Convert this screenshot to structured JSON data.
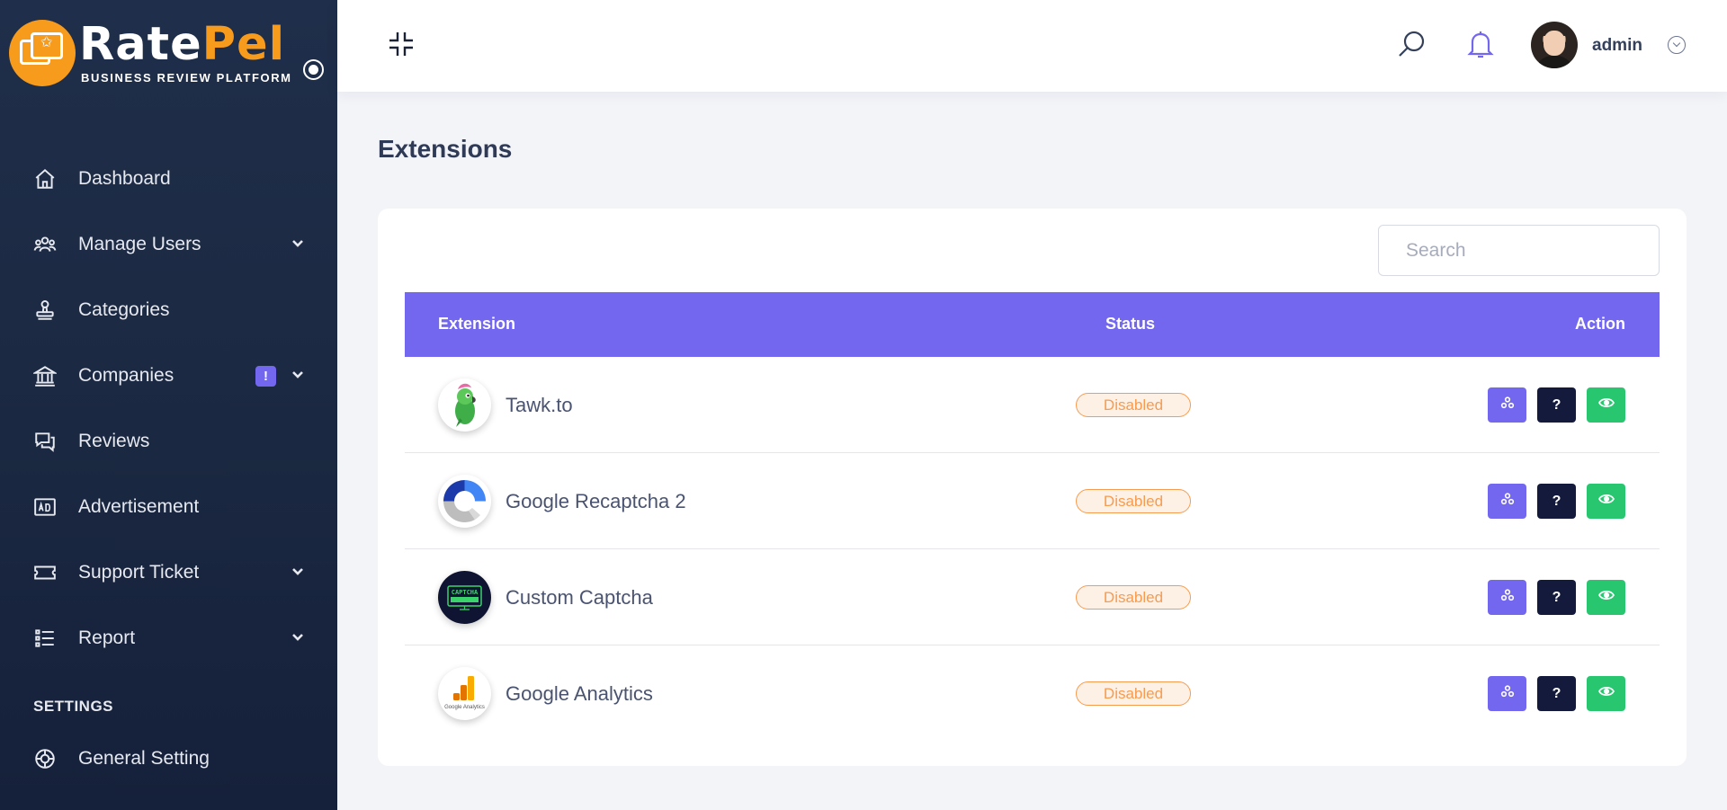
{
  "brand": {
    "name_part1": "Rate",
    "name_part2": "Pel",
    "tagline": "BUSINESS REVIEW PLATFORM"
  },
  "sidebar": {
    "items": [
      {
        "label": "Dashboard",
        "icon": "home-icon"
      },
      {
        "label": "Manage Users",
        "icon": "users-icon",
        "has_submenu": true
      },
      {
        "label": "Categories",
        "icon": "stamp-icon"
      },
      {
        "label": "Companies",
        "icon": "bank-icon",
        "has_submenu": true,
        "badge": "!"
      },
      {
        "label": "Reviews",
        "icon": "chat-icon"
      },
      {
        "label": "Advertisement",
        "icon": "ad-icon"
      },
      {
        "label": "Support Ticket",
        "icon": "ticket-icon",
        "has_submenu": true
      },
      {
        "label": "Report",
        "icon": "list-icon",
        "has_submenu": true
      }
    ],
    "section_label": "SETTINGS",
    "settings_items": [
      {
        "label": "General Setting",
        "icon": "settings-icon"
      }
    ]
  },
  "header": {
    "user_name": "admin"
  },
  "page": {
    "title": "Extensions"
  },
  "search": {
    "placeholder": "Search",
    "value": ""
  },
  "table": {
    "columns": [
      "Extension",
      "Status",
      "Action"
    ],
    "rows": [
      {
        "name": "Tawk.to",
        "status": "Disabled",
        "logo": "tawkto-parrot-icon"
      },
      {
        "name": "Google Recaptcha 2",
        "status": "Disabled",
        "logo": "recaptcha-icon"
      },
      {
        "name": "Custom Captcha",
        "status": "Disabled",
        "logo": "custom-captcha-icon",
        "logo_text": "CAPTCHA"
      },
      {
        "name": "Google Analytics",
        "status": "Disabled",
        "logo": "google-analytics-icon",
        "logo_text": "Google Analytics"
      }
    ],
    "help_glyph": "?"
  },
  "colors": {
    "sidebar_bg": "#1f2e4a",
    "accent": "#7367f0",
    "brand_orange": "#f79b1c",
    "status_disabled": "#f79b4e",
    "success": "#28c76f",
    "dark": "#141a3b"
  }
}
